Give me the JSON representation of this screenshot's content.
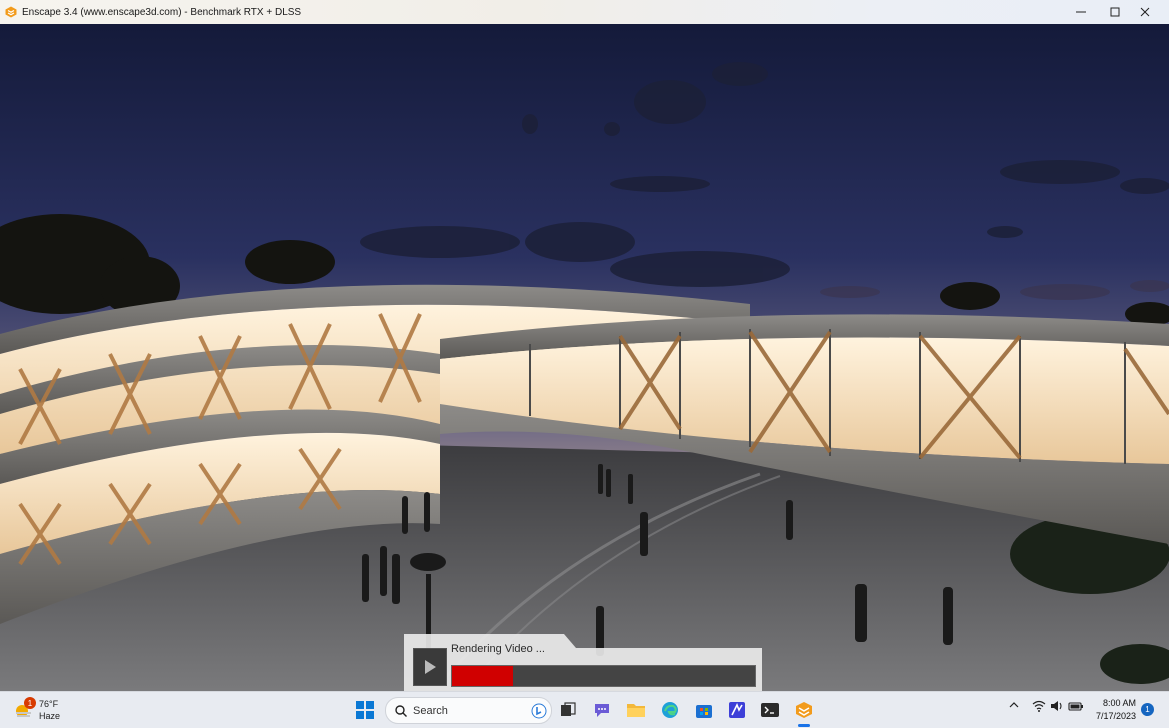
{
  "window": {
    "title": "Enscape 3.4 (www.enscape3d.com) - Benchmark RTX + DLSS",
    "app_icon": "enscape-logo-icon",
    "controls": [
      "minimize-icon",
      "maximize-icon",
      "close-icon"
    ]
  },
  "overlay": {
    "status_label": "Rendering Video ...",
    "progress": 0.2,
    "progress_color": "#d00000",
    "play_icon": "play-icon"
  },
  "taskbar": {
    "weather": {
      "temp": "76°F",
      "condition": "Haze",
      "badge": "1"
    },
    "search": {
      "placeholder": "Search"
    },
    "apps": [
      "start-icon",
      "search-icon",
      "bing-icon",
      "task-view-icon",
      "chat-icon",
      "file-explorer-icon",
      "edge-icon",
      "store-icon",
      "app-icon",
      "terminal-icon",
      "enscape-icon"
    ],
    "tray": [
      "chevron-up-icon",
      "wifi-icon",
      "volume-icon",
      "battery-icon"
    ],
    "clock": {
      "time": "8:00 AM",
      "date": "7/17/2023"
    },
    "notifications": "1"
  }
}
